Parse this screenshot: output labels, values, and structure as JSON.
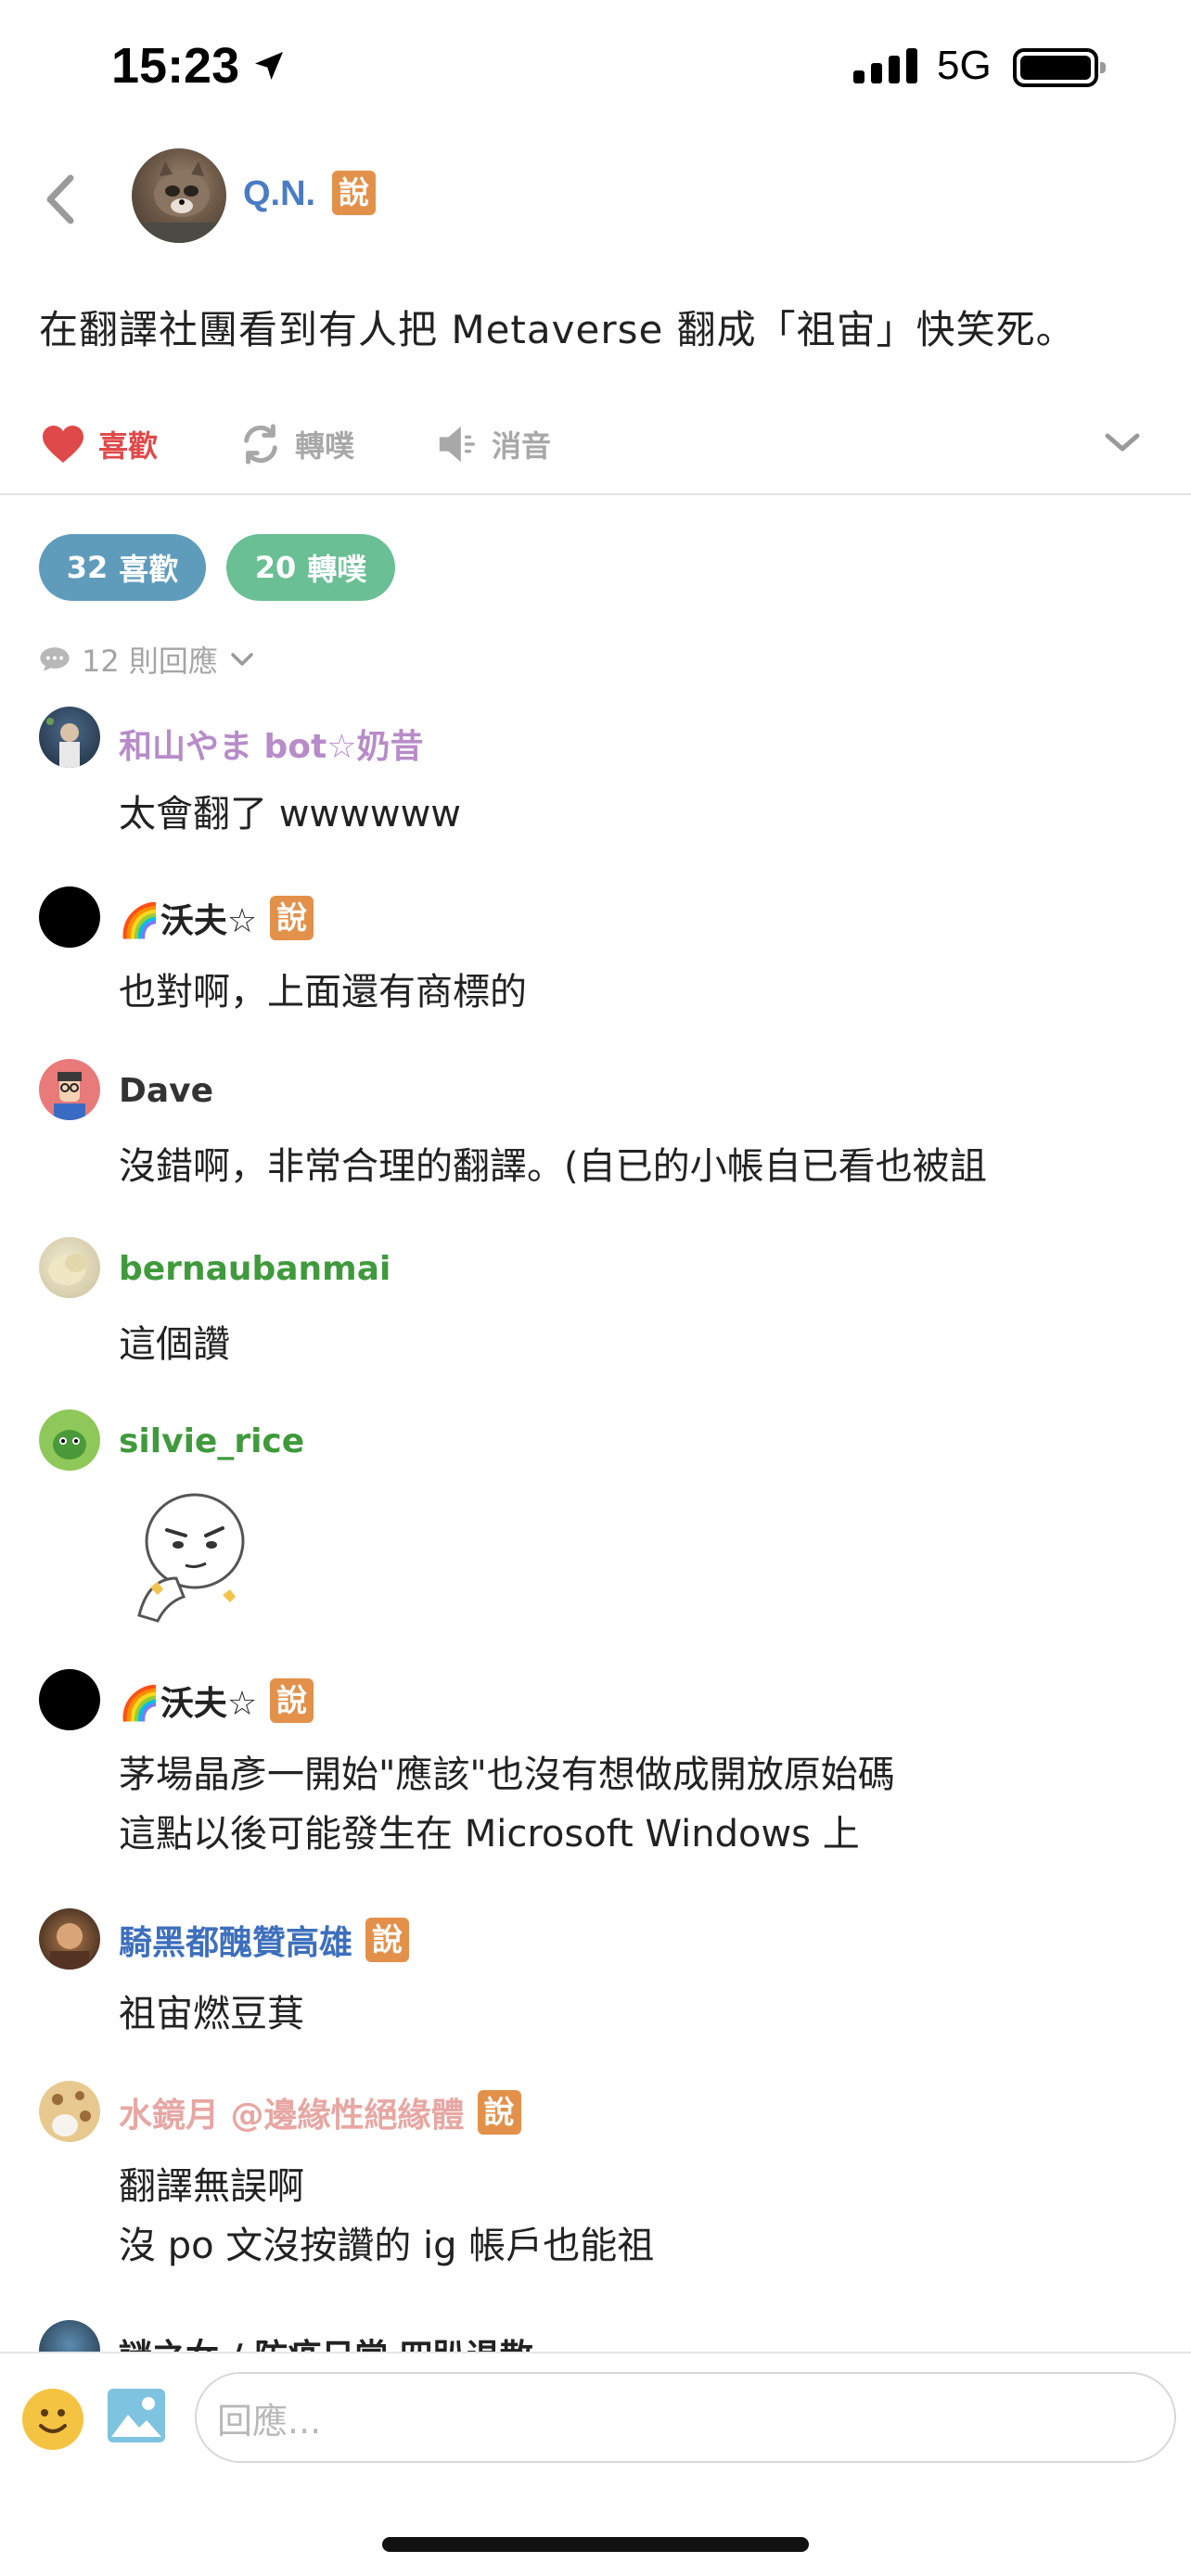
{
  "status_bar": {
    "time": "15:23",
    "network": "5G"
  },
  "header": {
    "name": "Q.N.",
    "badge": "說"
  },
  "post": {
    "text": "在翻譯社團看到有人把 Metaverse 翻成「祖宙」快笑死。"
  },
  "actions": {
    "like": "喜歡",
    "replurk": "轉噗",
    "mute": "消音"
  },
  "stats": {
    "likes_count": "32",
    "likes_label": "喜歡",
    "replurks_count": "20",
    "replurks_label": "轉噗"
  },
  "reply_count": "12 則回應",
  "responses": [
    {
      "name": "和山やま bot☆奶昔",
      "name_color": "#b78cc9",
      "badge": "",
      "lines": [
        "太會翻了 wwwwww"
      ]
    },
    {
      "name": "🌈沃夫☆",
      "name_color": "#222222",
      "badge": "說",
      "lines": [
        "也對啊，上面還有商標的"
      ]
    },
    {
      "name": "Dave",
      "name_color": "#333333",
      "badge": "",
      "lines": [
        "沒錯啊，非常合理的翻譯。(自已的小帳自已看也被詛"
      ]
    },
    {
      "name": "bernaubanmai",
      "name_color": "#3f9a3c",
      "badge": "",
      "lines": [
        "這個讚"
      ]
    },
    {
      "name": "silvie_rice",
      "name_color": "#3f9a3c",
      "badge": "",
      "lines": []
    },
    {
      "name": "🌈沃夫☆",
      "name_color": "#222222",
      "badge": "說",
      "lines": [
        "茅場晶彥一開始\"應該\"也沒有想做成開放原始碼",
        "這點以後可能發生在 Microsoft Windows 上"
      ]
    },
    {
      "name": "騎黑都醜贊高雄",
      "name_color": "#3d6fbd",
      "badge": "說",
      "lines": [
        "祖宙燃豆萁"
      ]
    },
    {
      "name": "水鏡月 @邊緣性絕緣體",
      "name_color": "#e7a7a3",
      "badge": "說",
      "lines": [
        "翻譯無誤啊",
        "沒 po 文沒按讚的 ig 帳戶也能祖"
      ]
    },
    {
      "name": "謎之女 / 防疫日常 四趴退散",
      "name_color": "#222222",
      "badge": "",
      "lines": []
    }
  ],
  "input": {
    "placeholder": "回應..."
  },
  "colors": {
    "like": "#e0494a",
    "likes_pill": "#5f9cbc",
    "replurks_pill": "#6abf94",
    "badge": "#e3914a",
    "op_name": "#4a7cc4"
  }
}
